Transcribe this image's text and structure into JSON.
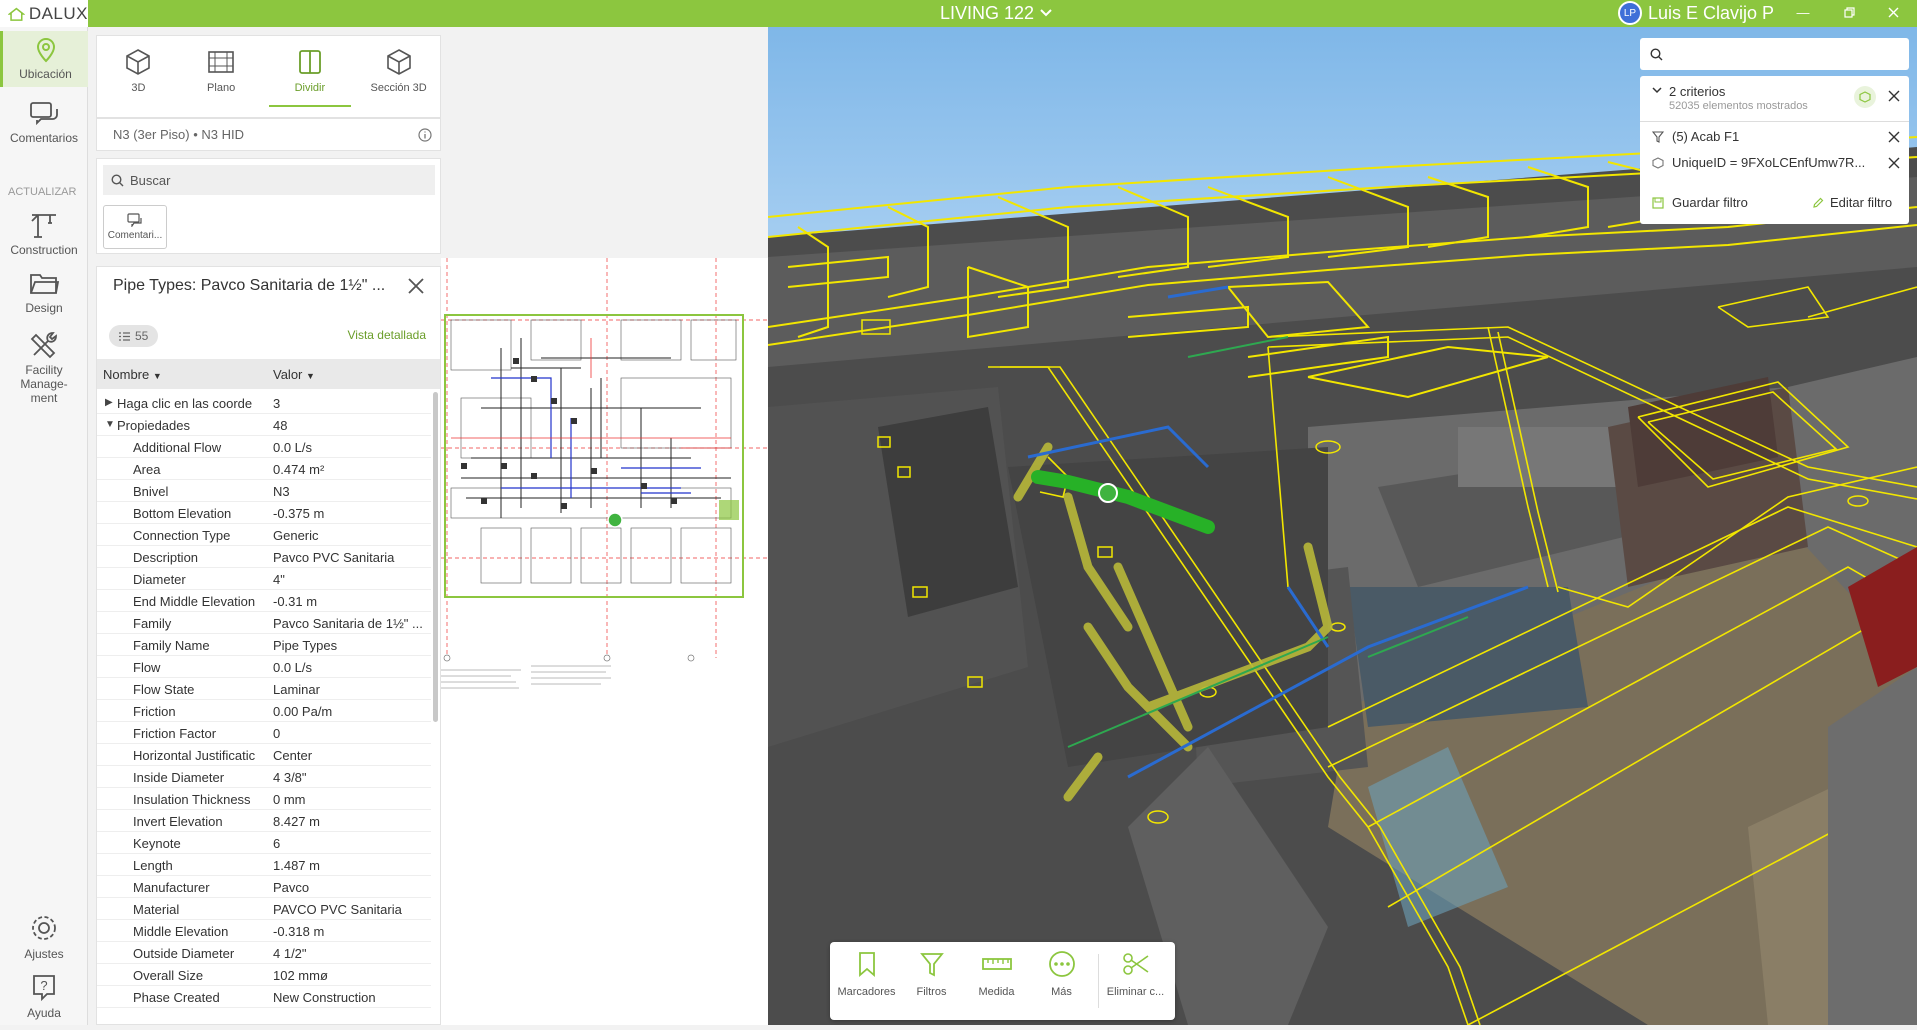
{
  "header": {
    "logo_text": "DALUX",
    "project_title": "LIVING 122",
    "user_initials": "LP",
    "user_name": "Luis E Clavijo P"
  },
  "leftnav": {
    "items": [
      {
        "label": "Ubicación",
        "icon": "location-pin-icon"
      },
      {
        "label": "Comentarios",
        "icon": "comments-icon"
      }
    ],
    "section_label": "ACTUALIZAR",
    "update_items": [
      {
        "label": "Construction",
        "icon": "crane-icon"
      },
      {
        "label": "Design",
        "icon": "folder-icon"
      },
      {
        "label": "Facility Manage-ment",
        "icon": "tools-icon"
      }
    ],
    "bottom_items": [
      {
        "label": "Ajustes",
        "icon": "gear-icon"
      },
      {
        "label": "Ayuda",
        "icon": "help-icon"
      }
    ]
  },
  "view_tabs": [
    {
      "label": "3D"
    },
    {
      "label": "Plano"
    },
    {
      "label": "Dividir"
    },
    {
      "label": "Sección 3D"
    }
  ],
  "location_text": "N3 (3er Piso) • N3 HID",
  "search": {
    "placeholder": "Buscar",
    "chip_label": "Comentari..."
  },
  "properties": {
    "title": "Pipe Types: Pavco Sanitaria de 1½\" ...",
    "count": "55",
    "detail_link": "Vista detallada",
    "col_name": "Nombre",
    "col_value": "Valor",
    "group1": {
      "label": "Haga clic en las coorder",
      "value": "3"
    },
    "group2": {
      "label": "Propiedades",
      "value": "48"
    },
    "rows": [
      {
        "k": "Additional Flow",
        "v": "0.0 L/s"
      },
      {
        "k": "Area",
        "v": "0.474 m²"
      },
      {
        "k": "Bnivel",
        "v": "N3"
      },
      {
        "k": "Bottom Elevation",
        "v": "-0.375 m"
      },
      {
        "k": "Connection Type",
        "v": "Generic"
      },
      {
        "k": "Description",
        "v": "Pavco PVC Sanitaria"
      },
      {
        "k": "Diameter",
        "v": "4\""
      },
      {
        "k": "End Middle Elevation",
        "v": "-0.31 m"
      },
      {
        "k": "Family",
        "v": "Pavco Sanitaria de 1½\" ..."
      },
      {
        "k": "Family Name",
        "v": "Pipe Types"
      },
      {
        "k": "Flow",
        "v": "0.0 L/s"
      },
      {
        "k": "Flow State",
        "v": "Laminar"
      },
      {
        "k": "Friction",
        "v": "0.00 Pa/m"
      },
      {
        "k": "Friction Factor",
        "v": "0"
      },
      {
        "k": "Horizontal Justificatic",
        "v": "Center"
      },
      {
        "k": "Inside Diameter",
        "v": "4 3/8\""
      },
      {
        "k": "Insulation Thickness",
        "v": "0 mm"
      },
      {
        "k": "Invert Elevation",
        "v": "8.427 m"
      },
      {
        "k": "Keynote",
        "v": "6"
      },
      {
        "k": "Length",
        "v": "1.487 m"
      },
      {
        "k": "Manufacturer",
        "v": "Pavco"
      },
      {
        "k": "Material",
        "v": "PAVCO PVC Sanitaria"
      },
      {
        "k": "Middle Elevation",
        "v": "-0.318 m"
      },
      {
        "k": "Outside Diameter",
        "v": "4 1/2\""
      },
      {
        "k": "Overall Size",
        "v": "102 mmø"
      },
      {
        "k": "Phase Created",
        "v": "New Construction"
      }
    ]
  },
  "filters": {
    "criteria_title": "2 criterios",
    "criteria_sub": "52035 elementos mostrados",
    "filter1": "(5) Acab F1",
    "filter2": "UniqueID = 9FXoLCEnfUmw7R...",
    "save": "Guardar filtro",
    "edit": "Editar filtro"
  },
  "toolbar": [
    {
      "label": "Marcadores",
      "icon": "bookmark-icon"
    },
    {
      "label": "Filtros",
      "icon": "filter-icon"
    },
    {
      "label": "Medida",
      "icon": "ruler-icon"
    },
    {
      "label": "Más",
      "icon": "more-icon"
    },
    {
      "label": "Eliminar c...",
      "icon": "scissors-icon"
    }
  ],
  "colors": {
    "accent": "#8cc63f",
    "highlight": "#f2e600",
    "selected_pipe": "#3fb33f"
  }
}
